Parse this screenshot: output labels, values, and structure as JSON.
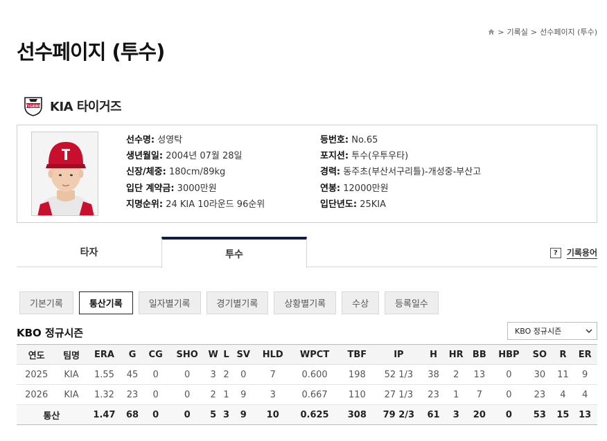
{
  "breadcrumb": {
    "sep1": ">",
    "item1": "기록실",
    "sep2": ">",
    "item2": "선수페이지 (투수)"
  },
  "page_title": "선수페이지 (투수)",
  "team": {
    "logo_text": "TIGERS",
    "name": "KIA 타이거즈"
  },
  "player": {
    "name_label": "선수명:",
    "name": "성영탁",
    "birth_label": "생년월일:",
    "birth": "2004년 07월 28일",
    "body_label": "신장/체중:",
    "body": "180cm/89kg",
    "signing_label": "입단 계약금:",
    "signing": "3000만원",
    "draft_label": "지명순위:",
    "draft": "24 KIA 10라운드 96순위",
    "number_label": "등번호:",
    "number": "No.65",
    "position_label": "포지션:",
    "position": "투수(우투우타)",
    "career_label": "경력:",
    "career": "동주초(부산서구리틀)-개성중-부산고",
    "salary_label": "연봉:",
    "salary": "12000만원",
    "year_label": "입단년도:",
    "year": "25KIA"
  },
  "tabs": {
    "batter": "타자",
    "pitcher": "투수"
  },
  "glossary": {
    "icon": "?",
    "label": "기록용어"
  },
  "subtabs": [
    "기본기록",
    "통산기록",
    "일자별기록",
    "경기별기록",
    "상황별기록",
    "수상",
    "등록일수"
  ],
  "active_subtab": "통산기록",
  "season": {
    "title": "KBO 정규시즌",
    "select_value": "KBO 정규시즌"
  },
  "stats": {
    "headers": [
      "연도",
      "팀명",
      "ERA",
      "G",
      "CG",
      "SHO",
      "W",
      "L",
      "SV",
      "HLD",
      "WPCT",
      "TBF",
      "IP",
      "H",
      "HR",
      "BB",
      "HBP",
      "SO",
      "R",
      "ER"
    ],
    "rows": [
      [
        "2025",
        "KIA",
        "1.55",
        "45",
        "0",
        "0",
        "3",
        "2",
        "0",
        "7",
        "0.600",
        "198",
        "52 1/3",
        "38",
        "2",
        "13",
        "0",
        "30",
        "11",
        "9"
      ],
      [
        "2026",
        "KIA",
        "1.32",
        "23",
        "0",
        "0",
        "2",
        "1",
        "9",
        "3",
        "0.667",
        "110",
        "27 1/3",
        "23",
        "1",
        "7",
        "0",
        "23",
        "4",
        "4"
      ]
    ],
    "total": [
      "통산",
      "1.47",
      "68",
      "0",
      "0",
      "5",
      "3",
      "9",
      "10",
      "0.625",
      "308",
      "79 2/3",
      "61",
      "3",
      "20",
      "0",
      "53",
      "15",
      "13"
    ]
  },
  "colors": {
    "tab_accent": "#0f1e3d",
    "team_red": "#c8102e"
  }
}
